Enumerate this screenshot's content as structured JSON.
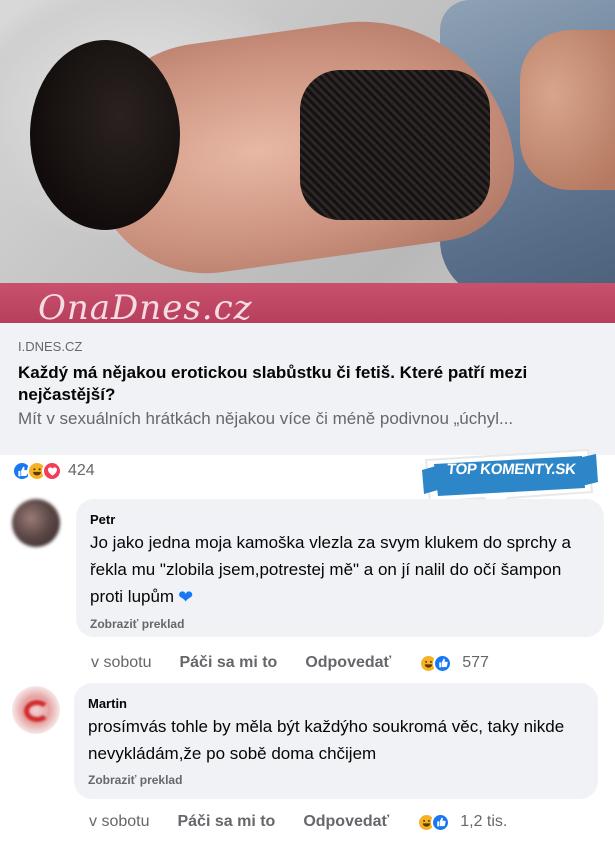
{
  "preview": {
    "brand": "OnaDnes.cz",
    "domain": "I.DNES.CZ",
    "title": "Každý má nějakou erotickou slabůstku či fetiš. Které patří mezi nejčastější?",
    "description": "Mít v sexuálních hrátkách nějakou více či méně podivnou „úchyl..."
  },
  "reactions": {
    "icons": [
      "like-icon",
      "haha-icon",
      "love-icon"
    ],
    "count": "424"
  },
  "badge": {
    "text": "TOP KOMENTY.SK",
    "color": "#2d86c8"
  },
  "comments": [
    {
      "author": "Petr",
      "text": "Jo jako jedna moja kamoška vlezla za svym klukem do sprchy a řekla mu \"zlobila jsem,potrestej mě\" a on jí nalil do očí šampon proti lupům",
      "emoji": "blue-heart-icon",
      "translate": "Zobraziť preklad",
      "time": "v sobotu",
      "like": "Páči sa mi to",
      "reply": "Odpovedať",
      "reaction_icons": [
        "haha-icon",
        "like-icon"
      ],
      "reaction_count": "577"
    },
    {
      "author": "Martin",
      "text": "prosímvás tohle by měla být každýho soukromá věc, taky nikde nevykládám,že po sobě doma chčijem",
      "translate": "Zobraziť preklad",
      "time": "v sobotu",
      "like": "Páči sa mi to",
      "reply": "Odpovedať",
      "reaction_icons": [
        "haha-icon",
        "like-icon"
      ],
      "reaction_count": "1,2 tis."
    }
  ],
  "colors": {
    "brand_bar": "#b63f5d",
    "link_blue": "#1877f2",
    "bubble": "#f0f2f5",
    "muted": "#65676b"
  }
}
